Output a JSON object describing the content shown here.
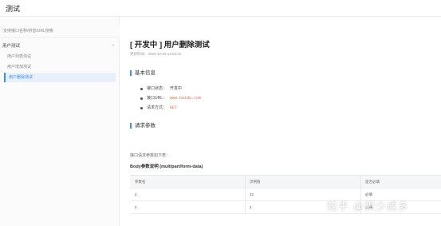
{
  "app": {
    "title": "测试"
  },
  "sidebar": {
    "search_placeholder": "支持接口名称/拼音/URL搜索",
    "group": {
      "label": "用户测试",
      "expand_icon": "chevron-down-icon"
    },
    "items": [
      {
        "label": "用户列表测试",
        "active": false
      },
      {
        "label": "用户增加测试",
        "active": false
      },
      {
        "label": "用户删除测试",
        "active": true
      }
    ]
  },
  "main": {
    "title": "[ 开发中 ] 用户删除测试",
    "update_time": "更新时间：2020-10-20 14:53:21",
    "basic_info": {
      "heading": "基本信息",
      "rows": [
        {
          "label": "接口状态：",
          "value": "开发中"
        },
        {
          "label": "接口URL：",
          "value": "www.baidu.com"
        },
        {
          "label": "请求方式：",
          "value": "GET"
        }
      ]
    },
    "request_params": {
      "heading": "请求参数",
      "description": "接口请求参数如下表：",
      "body_title": "Body参数说明 (multipart/form-data)",
      "table": {
        "headers": [
          "参数名",
          "示例值",
          "是否必填"
        ],
        "rows": [
          [
            "2",
            "22",
            "必填"
          ],
          [
            "2",
            "2",
            "必填"
          ]
        ]
      }
    }
  },
  "watermark": "知乎 @积少成多",
  "colors": {
    "accent": "#3a8ee6",
    "highlight_value": "#e0734a"
  }
}
